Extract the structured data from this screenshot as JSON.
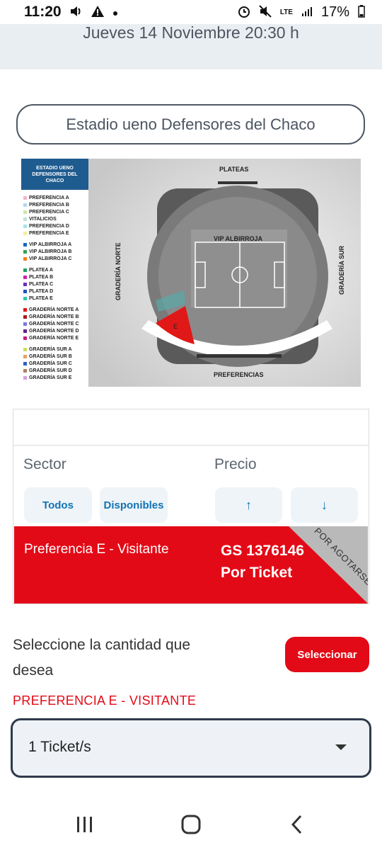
{
  "status_bar": {
    "time": "11:20",
    "battery": "17%",
    "network": "LTE",
    "icons": [
      "volume-icon",
      "alert-icon",
      "dot-icon",
      "alarm-icon",
      "mute-icon",
      "signal-icon",
      "battery-icon"
    ]
  },
  "event": {
    "date_time": "Jueves 14 Noviembre 20:30 h",
    "venue": "Estadio ueno Defensores del Chaco"
  },
  "map": {
    "legend_title": "ESTADIO UENO DEFENSORES DEL CHACO",
    "legend_groups": [
      [
        {
          "label": "PREFERENCIA A",
          "color": "#f2b6c6"
        },
        {
          "label": "PREFERENCIA B",
          "color": "#b5d7f0"
        },
        {
          "label": "PREFERENCIA C",
          "color": "#cde8a9"
        },
        {
          "label": "VITALICIOS",
          "color": "#bfe3d8"
        },
        {
          "label": "PREFERENCIA D",
          "color": "#a8e4e6"
        },
        {
          "label": "PREFERENCIA E",
          "color": "#f4ee9a"
        }
      ],
      [
        {
          "label": "VIP ALBIRROJA A",
          "color": "#1a66c0"
        },
        {
          "label": "VIP ALBIRROJA B",
          "color": "#2fa44f"
        },
        {
          "label": "VIP ALBIRROJA C",
          "color": "#f08020"
        }
      ],
      [
        {
          "label": "PLATEA A",
          "color": "#22a060"
        },
        {
          "label": "PLATEA B",
          "color": "#d020b0"
        },
        {
          "label": "PLATEA C",
          "color": "#6a30c0"
        },
        {
          "label": "PLATEA D",
          "color": "#2050c8"
        },
        {
          "label": "PLATEA E",
          "color": "#30c8a8"
        }
      ],
      [
        {
          "label": "GRADERÍA NORTE A",
          "color": "#e01818"
        },
        {
          "label": "GRADERÍA NORTE B",
          "color": "#b01818"
        },
        {
          "label": "GRADERÍA NORTE C",
          "color": "#7a7ad8"
        },
        {
          "label": "GRADERÍA NORTE D",
          "color": "#6a2090"
        },
        {
          "label": "GRADERÍA NORTE E",
          "color": "#c02080"
        }
      ],
      [
        {
          "label": "GRADERÍA SUR A",
          "color": "#c8e060"
        },
        {
          "label": "GRADERÍA SUR B",
          "color": "#e8a060"
        },
        {
          "label": "GRADERÍA SUR C",
          "color": "#3060c0"
        },
        {
          "label": "GRADERÍA SUR D",
          "color": "#b08060"
        },
        {
          "label": "GRADERÍA SUR E",
          "color": "#d8a0e0"
        }
      ]
    ],
    "label_plateas": "PLATEAS",
    "label_vip": "VIP ALBIRROJA",
    "label_norte": "GRADERÍA NORTE",
    "label_sur": "GRADERÍA SUR",
    "label_preferencias": "PREFERENCIAS",
    "highlighted_sector": "E"
  },
  "table": {
    "col_sector": "Sector",
    "col_precio": "Precio",
    "filters": {
      "all": "Todos",
      "available": "Disponibles",
      "sort_up": "↑",
      "sort_down": "↓"
    },
    "ticket": {
      "name": "Preferencia E - Visitante",
      "price": "GS 1376146",
      "per": "Por Ticket",
      "badge": "POR AGOTARSE"
    }
  },
  "quantity": {
    "prompt": "Seleccione la cantidad que desea",
    "select_button": "Seleccionar",
    "sector_name": "PREFERENCIA E - VISITANTE",
    "selected_option": "1 Ticket/s"
  },
  "colors": {
    "accent_red": "#e30a17",
    "link_blue": "#1273b6",
    "header_band": "#e9eef2"
  }
}
